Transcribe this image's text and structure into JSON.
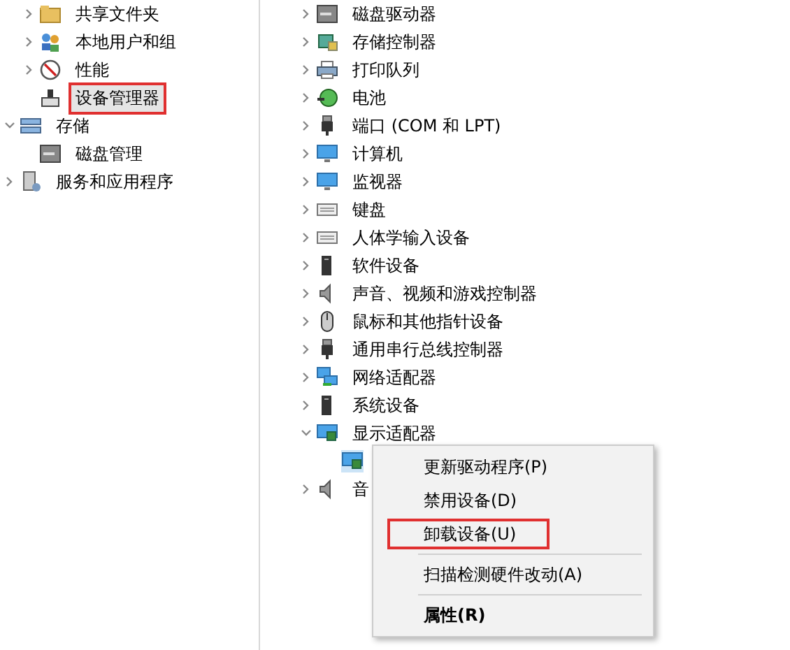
{
  "left_tree": [
    {
      "children": [
        {
          "label": "共享文件夹",
          "expanded": false,
          "selected": false,
          "annotated": false
        },
        {
          "label": "本地用户和组",
          "expanded": false,
          "selected": false,
          "annotated": false
        },
        {
          "label": "性能",
          "expanded": false,
          "selected": false,
          "annotated": false
        },
        {
          "label": "设备管理器",
          "selected": true,
          "annotated": true
        }
      ]
    },
    {
      "label": "存储",
      "expanded": true,
      "selected": false,
      "annotated": false,
      "children": [
        {
          "label": "磁盘管理",
          "selected": false,
          "annotated": false
        }
      ]
    },
    {
      "label": "服务和应用程序",
      "expanded": false,
      "selected": false,
      "annotated": false
    }
  ],
  "device_tree": [
    {
      "label": "磁盘驱动器",
      "expanded": false
    },
    {
      "label": "存储控制器",
      "expanded": false
    },
    {
      "label": "打印队列",
      "expanded": false
    },
    {
      "label": "电池",
      "expanded": false
    },
    {
      "label": "端口 (COM 和 LPT)",
      "expanded": false
    },
    {
      "label": "计算机",
      "expanded": false
    },
    {
      "label": "监视器",
      "expanded": false
    },
    {
      "label": "键盘",
      "expanded": false
    },
    {
      "label": "人体学输入设备",
      "expanded": false
    },
    {
      "label": "软件设备",
      "expanded": false
    },
    {
      "label": "声音、视频和游戏控制器",
      "expanded": false
    },
    {
      "label": "鼠标和其他指针设备",
      "expanded": false
    },
    {
      "label": "通用串行总线控制器",
      "expanded": false
    },
    {
      "label": "网络适配器",
      "expanded": false
    },
    {
      "label": "系统设备",
      "expanded": false
    },
    {
      "label": "显示适配器",
      "expanded": true,
      "children": [
        {
          "selected": true
        }
      ]
    },
    {
      "label": "音",
      "expanded": false
    }
  ],
  "context_menu": [
    {
      "kind": "item",
      "label": "更新驱动程序(P)",
      "annotated": false
    },
    {
      "kind": "item",
      "label": "禁用设备(D)",
      "annotated": false
    },
    {
      "kind": "item",
      "label": "卸载设备(U)",
      "annotated": true
    },
    {
      "kind": "separator"
    },
    {
      "kind": "item",
      "label": "扫描检测硬件改动(A)",
      "annotated": false
    },
    {
      "kind": "separator"
    },
    {
      "kind": "default",
      "label": "属性(R)",
      "annotated": false
    }
  ]
}
